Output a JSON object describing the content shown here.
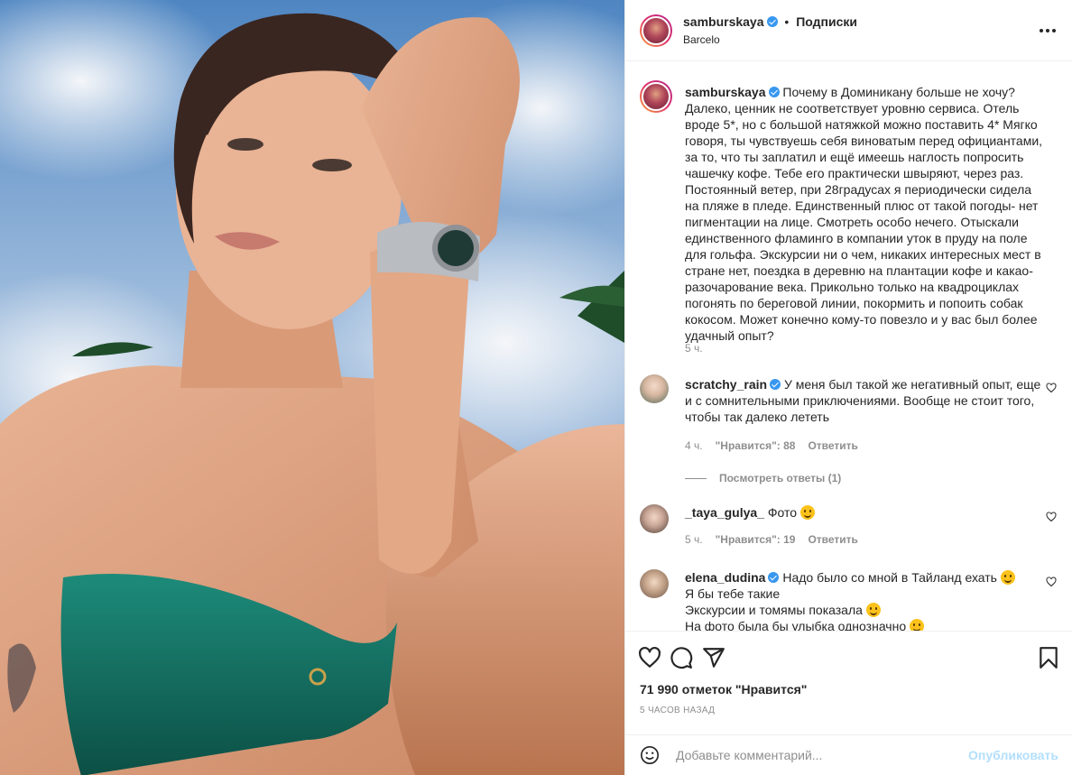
{
  "header": {
    "username": "samburskaya",
    "separator": "•",
    "follow_status": "Подписки",
    "location": "Barcelo",
    "more_icon": "ellipsis-horizontal-icon"
  },
  "caption": {
    "username": "samburskaya",
    "text": "Почему в Доминикану больше не хочу? Далеко, ценник не соответствует уровню сервиса. Отель вроде 5*, но с большой натяжкой можно поставить 4* Мягко говоря, ты чувствуешь себя виноватым перед официантами, за то, что ты заплатил и ещё имеешь наглость попросить чашечку кофе. Тебе его практически швыряют, через раз. Постоянный ветер, при 28градусах я периодически сидела на пляже в пледе. Единственный плюс от такой погоды- нет пигментации на лице. Смотреть особо нечего. Отыскали единственного фламинго в компании уток в пруду на поле для гольфа. Экскурсии ни о чем, никаких интересных мест в стране нет, поездка в деревню на плантации кофе и какао- разочарование века. Прикольно только на квадроциклах погонять по береговой линии, покормить и попоить собак кокосом. Может конечно кому-то повезло и у вас был более удачный опыт?",
    "time": "5 ч."
  },
  "comments": [
    {
      "username": "scratchy_rain",
      "verified": true,
      "text": "У меня был такой же негативный опыт, еще и с сомнительными приключениями. Вообще не стоит того, чтобы так далеко лететь",
      "time": "4 ч.",
      "likes": "\"Нравится\": 88",
      "reply": "Ответить",
      "view_replies": "Посмотреть ответы (1)"
    },
    {
      "username": "_taya_gulya_",
      "verified": false,
      "text": "Фото",
      "time": "5 ч.",
      "likes": "\"Нравится\": 19",
      "reply": "Ответить"
    },
    {
      "username": "elena_dudina",
      "verified": true,
      "line1": "Надо было со мной в Тайланд ехать",
      "line2": "Я бы тебе такие",
      "line3": "Экскурсии и томямы показала",
      "line4": "На фото была бы улыбка однозначно"
    }
  ],
  "actions": {
    "like_icon": "heart-icon",
    "comment_icon": "comment-icon",
    "share_icon": "paper-plane-icon",
    "save_icon": "bookmark-icon",
    "likes": "71 990 отметок \"Нравится\"",
    "posted": "5 ЧАСОВ НАЗАД"
  },
  "add_comment": {
    "emoji_icon": "smiley-icon",
    "placeholder": "Добавьте комментарий...",
    "publish": "Опубликовать"
  },
  "colors": {
    "link_blue": "#3897f0",
    "publish_disabled": "#b2dffc",
    "muted_text": "#8e8e8e",
    "border": "#efefef"
  }
}
